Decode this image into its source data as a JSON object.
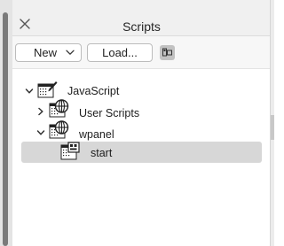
{
  "panel": {
    "title": "Scripts"
  },
  "toolbar": {
    "new_label": "New",
    "load_label": "Load..."
  },
  "tree": {
    "items": [
      {
        "label": "JavaScript",
        "icon": "script-folder-icon",
        "state": "expanded"
      },
      {
        "label": "User Scripts",
        "icon": "globe-folder-icon",
        "state": "collapsed"
      },
      {
        "label": "wpanel",
        "icon": "globe-folder-icon",
        "state": "expanded"
      },
      {
        "label": "start",
        "icon": "script-document-icon",
        "state": "selected"
      }
    ]
  },
  "colors": {
    "selection": "#d7d7d7",
    "titlebar": "#f0f0f0",
    "text": "#1d1d1d"
  }
}
